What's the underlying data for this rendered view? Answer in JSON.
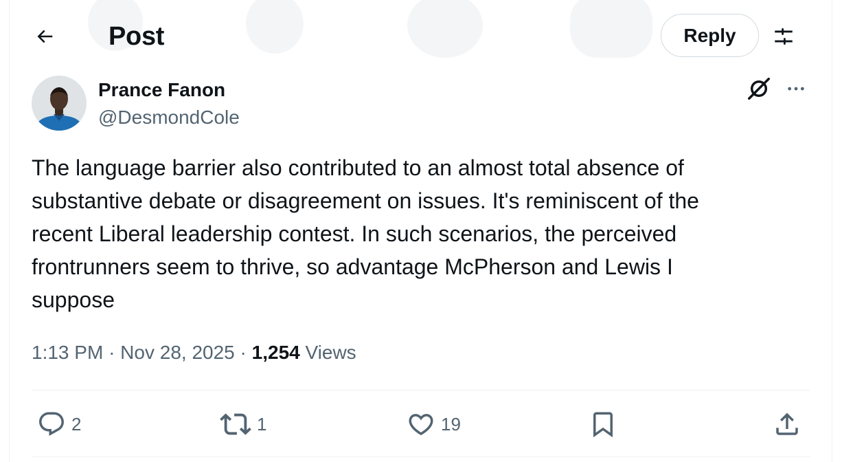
{
  "header": {
    "title": "Post",
    "reply_label": "Reply"
  },
  "author": {
    "display_name": "Prance Fanon",
    "handle": "@DesmondCole"
  },
  "post": {
    "lines": [
      "The language barrier also contributed to an almost total absence of",
      "substantive debate or disagreement on issues. It's reminiscent of the",
      "recent Liberal leadership contest. In such scenarios, the perceived",
      "frontrunners seem to thrive, so advantage McPherson and Lewis I",
      "suppose"
    ],
    "time": "1:13 PM",
    "date": "Nov 28, 2025",
    "views_count": "1,254",
    "views_label": "Views"
  },
  "actions": {
    "replies": "2",
    "reposts": "1",
    "likes": "19"
  },
  "icons": {
    "back": "arrow-left-icon",
    "filter": "sliders-icon",
    "grok": "grok-icon",
    "more": "more-dots-icon",
    "reply": "comment-icon",
    "repost": "repost-icon",
    "like": "heart-icon",
    "bookmark": "bookmark-icon",
    "share": "share-icon"
  },
  "colors": {
    "text_primary": "#0f1419",
    "text_secondary": "#536471",
    "border": "#cfd9de"
  }
}
